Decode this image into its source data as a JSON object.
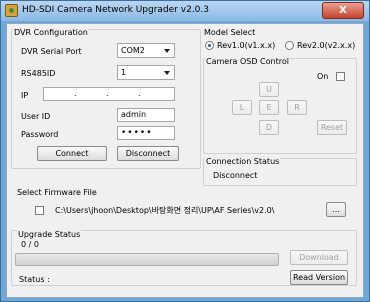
{
  "window": {
    "title": "HD-SDI Camera Network Upgrader v2.0.3",
    "close_glyph": "X"
  },
  "dvr": {
    "legend": "DVR Configuration",
    "serial_port_label": "DVR Serial Port",
    "serial_port_value": "COM2",
    "rs485_label": "RS485ID",
    "rs485_value": "1",
    "ip_label": "IP",
    "ip_sep": ".",
    "user_label": "User ID",
    "user_value": "admin",
    "password_label": "Password",
    "password_value": "•••••",
    "connect_label": "Connect",
    "disconnect_label": "Disconnect"
  },
  "model": {
    "legend": "Model Select",
    "option1": "Rev1.0(v1.x.x)",
    "option2": "Rev2.0(v2.x.x)",
    "selected": "Rev1.0(v1.x.x)"
  },
  "osd": {
    "legend": "Camera OSD Control",
    "on_label": "On",
    "up": "U",
    "left": "L",
    "enter": "E",
    "right": "R",
    "down": "D",
    "reset": "Reset"
  },
  "connection": {
    "legend": "Connection Status",
    "status": "Disconnect"
  },
  "firmware": {
    "legend": "Select Firmware File",
    "path": "C:\\Users\\jhoon\\Desktop\\바탕화면 정리\\UP\\AF Series\\v2.0\\",
    "browse_label": "..."
  },
  "upgrade": {
    "legend": "Upgrade Status",
    "counter": "0  /  0",
    "progress": 0,
    "status_label": "Status :",
    "download_label": "Download",
    "read_version_label": "Read Version"
  },
  "colors": {
    "progress_fill": "#48a248",
    "close_button": "#c7432d"
  }
}
